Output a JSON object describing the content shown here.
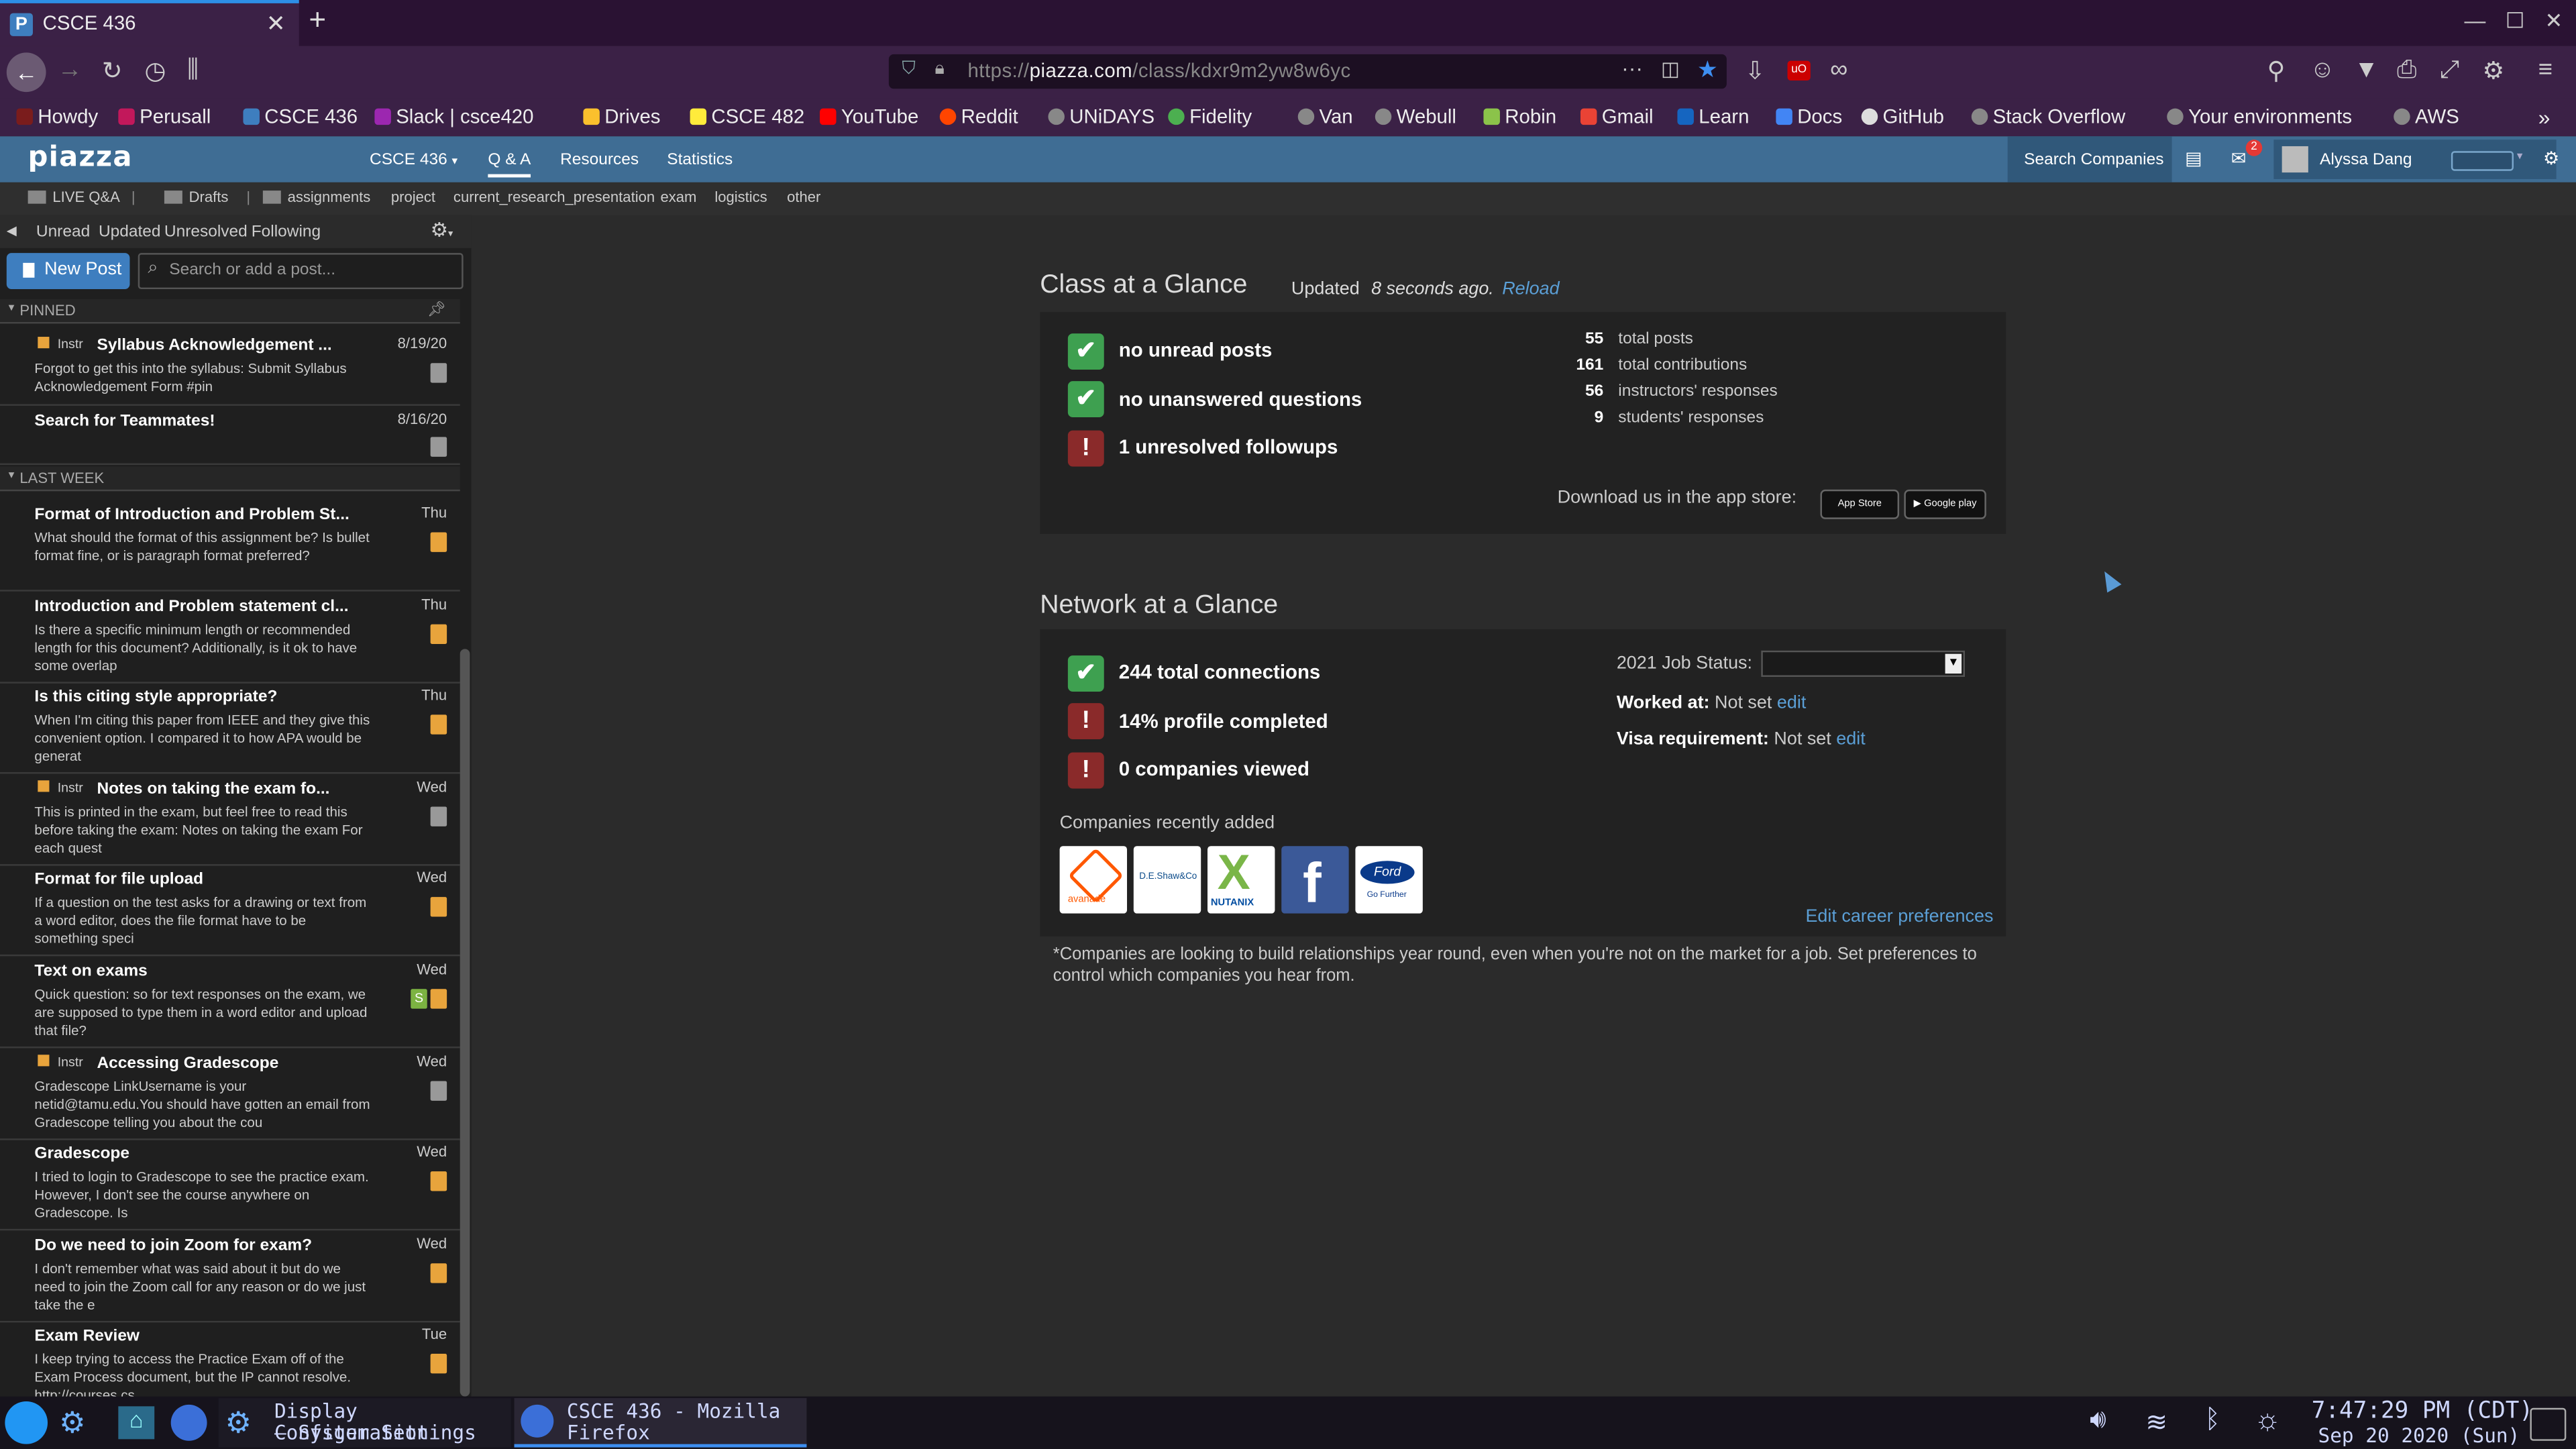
{
  "browser": {
    "tab_title": "CSCE 436",
    "url_prefix": "https://",
    "url_domain": "piazza.com",
    "url_path": "/class/kdxr9m2yw8w6yc",
    "bookmarks": [
      "Howdy",
      "Perusall",
      "CSCE 436",
      "Slack | csce420",
      "Drives",
      "CSCE 482",
      "YouTube",
      "Reddit",
      "UNiDAYS",
      "Fidelity",
      "Van",
      "Webull",
      "Robin",
      "Gmail",
      "Learn",
      "Docs",
      "GitHub",
      "Stack Overflow",
      "Your environments",
      "AWS"
    ]
  },
  "piazza": {
    "logo": "piazza",
    "class_name": "CSCE 436",
    "nav": [
      "Q & A",
      "Resources",
      "Statistics"
    ],
    "search_companies": "Search Companies",
    "notif_count": "2",
    "user": "Alyssa Dang",
    "folders": [
      "LIVE Q&A",
      "Drafts",
      "assignments",
      "project",
      "current_research_presentation",
      "exam",
      "logistics",
      "other"
    ]
  },
  "sidebar": {
    "filters": [
      "Unread",
      "Updated",
      "Unresolved",
      "Following"
    ],
    "new_post": "New Post",
    "search_placeholder": "Search or add a post...",
    "pinned_label": "PINNED",
    "lastweek_label": "LAST WEEK",
    "instr": "Instr",
    "pinned": [
      {
        "title": "Syllabus Acknowledgement ...",
        "date": "8/19/20",
        "body": "Forgot to get this into the syllabus: Submit Syllabus Acknowledgement Form #pin"
      },
      {
        "title": "Search for Teammates!",
        "date": "8/16/20",
        "body": ""
      }
    ],
    "posts": [
      {
        "title": "Format of Introduction and Problem St...",
        "date": "Thu",
        "body": "What should the format of this assignment be? Is bullet format fine, or is paragraph format preferred?"
      },
      {
        "title": "Introduction and Problem statement cl...",
        "date": "Thu",
        "body": "Is there a specific minimum length or recommended length for this document? Additionally, is it ok to have some overlap"
      },
      {
        "title": "Is this citing style appropriate?",
        "date": "Thu",
        "body": "When I'm citing this paper from IEEE and they give this convenient option. I compared it to how APA would be generat"
      },
      {
        "title": "Notes on taking the exam fo...",
        "date": "Wed",
        "body": "This is printed in the exam, but feel free to read this before taking the exam: Notes on taking the exam For each quest"
      },
      {
        "title": "Format for file upload",
        "date": "Wed",
        "body": "If a question on the test asks for a drawing or text from a word editor, does the file format have to be something speci"
      },
      {
        "title": "Text on exams",
        "date": "Wed",
        "body": "Quick question: so for text responses on the exam, we are supposed to type them in a word editor and upload that file?",
        "s_badge": "S"
      },
      {
        "title": "Accessing Gradescope",
        "date": "Wed",
        "body": "Gradescope LinkUsername is your netid@tamu.edu.You should have gotten an email from Gradescope telling you about the cou"
      },
      {
        "title": "Gradescope",
        "date": "Wed",
        "body": "I tried to login to Gradescope to see the practice exam. However, I don't see the course anywhere on Gradescope. Is"
      },
      {
        "title": "Do we need to join Zoom for exam?",
        "date": "Wed",
        "body": "I don't remember what was said about it but do we need to join the Zoom call for any reason or do we just take the e"
      },
      {
        "title": "Exam Review",
        "date": "Tue",
        "body": "I keep trying to access the Practice Exam off of the Exam Process document, but the IP cannot resolve. http://courses.cs"
      }
    ]
  },
  "class_glance": {
    "title": "Class at a Glance",
    "updated_prefix": "Updated",
    "updated_time": "8 seconds ago.",
    "reload": "Reload",
    "status": [
      "no unread posts",
      "no unanswered questions",
      "1 unresolved followups"
    ],
    "stats": [
      {
        "n": "55",
        "label": "total posts"
      },
      {
        "n": "161",
        "label": "total contributions"
      },
      {
        "n": "56",
        "label": "instructors' responses"
      },
      {
        "n": "9",
        "label": "students' responses"
      }
    ],
    "download": "Download us in the app store:",
    "appstore": "App Store",
    "googleplay": "Google play"
  },
  "network_glance": {
    "title": "Network at a Glance",
    "status": [
      "244 total connections",
      "14% profile completed",
      "0 companies viewed"
    ],
    "job_status_label": "2021 Job Status:",
    "worked_at_label": "Worked at:",
    "visa_label": "Visa requirement:",
    "not_set": "Not set",
    "edit": "edit",
    "companies_label": "Companies recently added",
    "companies": [
      "avanade",
      "D.E.Shaw&Co",
      "NUTANIX",
      "f",
      "Ford"
    ],
    "edit_career": "Edit career preferences",
    "footnote": "*Companies are looking to build relationships year round, even when you're not on the market for a job. Set preferences to control which companies you hear from."
  },
  "taskbar": {
    "app1": "Display Configuration",
    "app1b": "— System Settings",
    "app2": "CSCE 436 - Mozilla",
    "app2b": "Firefox",
    "time": "7:47:29 PM (CDT)",
    "date": "Sep 20 2020 (Sun)"
  },
  "colors": {
    "accent": "#3e7ebf",
    "ok": "#3ea050",
    "bad": "#8a2a2a",
    "topbar": "#3f6d94",
    "chrome": "#3b2146"
  }
}
